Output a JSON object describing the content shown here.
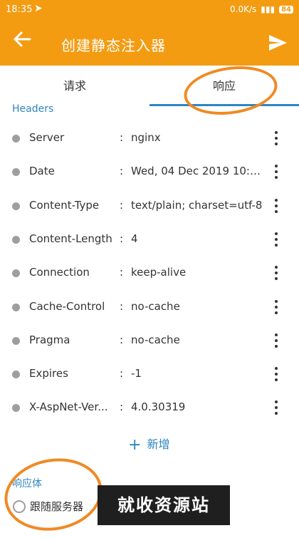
{
  "status_bar": {
    "time": "18:35",
    "network_speed": "0.0K/s",
    "battery": "84"
  },
  "app_bar": {
    "title": "创建静态注入器"
  },
  "tabs": [
    {
      "label": "请求"
    },
    {
      "label": "响应"
    }
  ],
  "headers_section": {
    "label": "Headers",
    "rows": [
      {
        "key": "Server",
        "value": "nginx"
      },
      {
        "key": "Date",
        "value": "Wed, 04 Dec 2019 10:3..."
      },
      {
        "key": "Content-Type",
        "value": "text/plain; charset=utf-8"
      },
      {
        "key": "Content-Length",
        "value": "4"
      },
      {
        "key": "Connection",
        "value": "keep-alive"
      },
      {
        "key": "Cache-Control",
        "value": "no-cache"
      },
      {
        "key": "Pragma",
        "value": "no-cache"
      },
      {
        "key": "Expires",
        "value": "-1"
      },
      {
        "key": "X-AspNet-Ver...",
        "value": "4.0.30319"
      }
    ],
    "add_label": "新增"
  },
  "body_section": {
    "label": "响应体",
    "option_label": "跟随服务器"
  },
  "watermark_text": "就收资源站",
  "colors": {
    "app_bar": "#f39c12",
    "accent": "#2e86c1",
    "annotation": "#f08a24"
  }
}
